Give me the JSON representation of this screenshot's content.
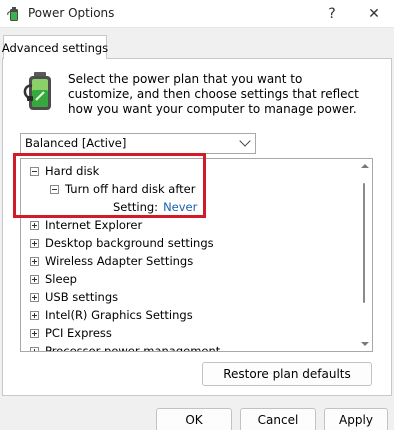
{
  "window": {
    "title": "Power Options",
    "help_glyph": "?",
    "close_glyph": "✕"
  },
  "tabs": [
    {
      "label": "Advanced settings"
    }
  ],
  "intro": {
    "text": "Select the power plan that you want to customize, and then choose settings that reflect how you want your computer to manage power."
  },
  "plan_select": {
    "selected": "Balanced [Active]"
  },
  "tree": {
    "expanded": {
      "label": "Hard disk",
      "child": {
        "label": "Turn off hard disk after",
        "setting_label": "Setting:",
        "setting_value": "Never"
      }
    },
    "items": [
      {
        "label": "Internet Explorer"
      },
      {
        "label": "Desktop background settings"
      },
      {
        "label": "Wireless Adapter Settings"
      },
      {
        "label": "Sleep"
      },
      {
        "label": "USB settings"
      },
      {
        "label": "Intel(R) Graphics Settings"
      },
      {
        "label": "PCI Express"
      },
      {
        "label": "Processor power management"
      }
    ]
  },
  "buttons": {
    "restore": "Restore plan defaults",
    "ok": "OK",
    "cancel": "Cancel",
    "apply": "Apply"
  },
  "colors": {
    "highlight": "#d11a2a",
    "setting_value": "#1a5fb4"
  },
  "icons": {
    "app": "power-options-icon",
    "plan": "battery-plug-icon"
  }
}
